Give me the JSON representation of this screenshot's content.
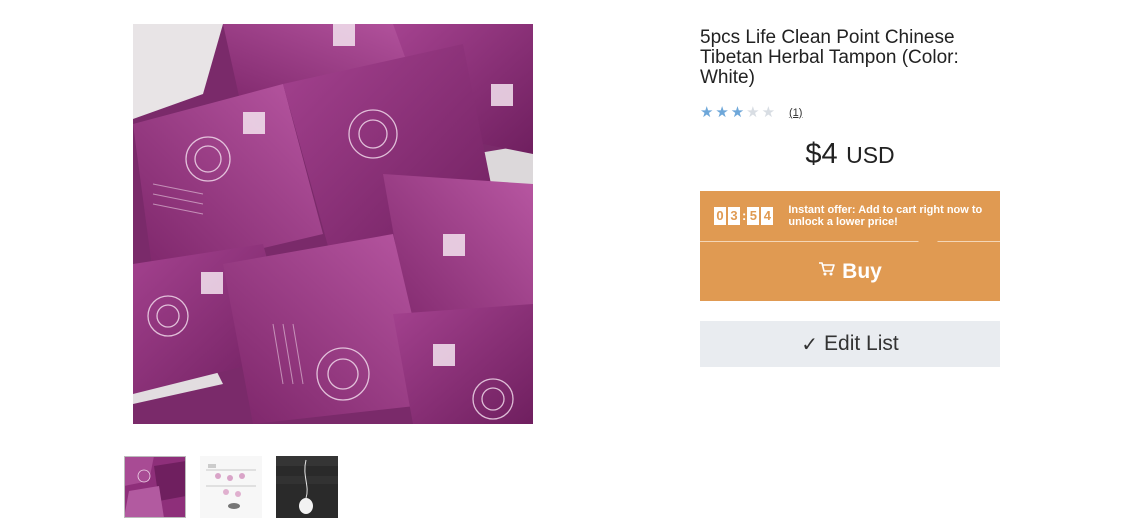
{
  "product": {
    "title": "5pcs Life Clean Point Chinese Tibetan Herbal Tampon (Color: White)",
    "rating": {
      "stars_filled": 3,
      "stars_total": 5,
      "review_count": "(1)"
    },
    "price": {
      "amount": "$4",
      "currency": "USD"
    }
  },
  "offer": {
    "timer_digits": [
      "0",
      "3",
      "5",
      "4"
    ],
    "timer_separator": ":",
    "text": "Instant offer: Add to cart right now to unlock a lower price!"
  },
  "buttons": {
    "buy_label": "Buy",
    "edit_list_label": "Edit List"
  },
  "icons": {
    "cart": "cart-icon",
    "check": "checkmark-icon",
    "star": "star-icon"
  },
  "gallery": {
    "selected_index": 0,
    "thumbnail_count": 3
  },
  "colors": {
    "accent_orange": "#e09a52",
    "star_blue": "#6ea7d9",
    "edit_list_bg": "#e9ecf0",
    "product_purple": "#8e2f7a"
  }
}
